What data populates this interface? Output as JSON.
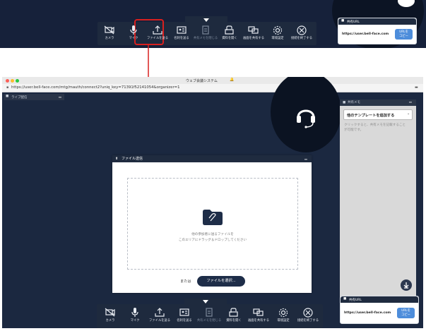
{
  "colors": {
    "navy": "#1e2a3e",
    "accent_blue": "#4d8ddb",
    "highlight_red": "#d9201f",
    "dialog_header": "#1f2b3f",
    "memo_gray": "#d9d9d9"
  },
  "toolbar_items": [
    {
      "label": "カメラ",
      "icon": "camera-off-icon"
    },
    {
      "label": "マイク",
      "icon": "microphone-icon"
    },
    {
      "label": "ファイルを送る",
      "icon": "upload-icon"
    },
    {
      "label": "名刺を送る",
      "icon": "business-card-icon"
    },
    {
      "label": "共有メモを閉じる",
      "icon": "memo-icon",
      "disabled": true
    },
    {
      "label": "資料を開く",
      "icon": "open-document-icon"
    },
    {
      "label": "画面を共有する",
      "icon": "screen-share-icon"
    },
    {
      "label": "環境設定",
      "icon": "settings-icon"
    },
    {
      "label": "接続を終了する",
      "icon": "end-call-icon"
    }
  ],
  "share_panel": {
    "title": "共有URL",
    "url": "https://user.bell-face.com",
    "copy_button": [
      "URLを",
      "コピー"
    ]
  },
  "browser": {
    "window_title": "ウェブ会議システム",
    "url": "https://user.bell-face.com/mtg/mauth/connect2?uniq_key=71391f52141054&organizer=1",
    "live_panel_label": "ライブ配信"
  },
  "memo": {
    "header": "共有メモ",
    "template_select": "他のテンプレートを追加する",
    "hint": "クリックすると、共有メモを記載することが可能です。"
  },
  "dialog": {
    "title": "ファイル送信",
    "drop_text_line1": "他の参加者に送るファイルを",
    "drop_text_line2": "このエリアにドラッグ＆ドロップしてください",
    "or_label": "または",
    "select_button": "ファイルを選択..."
  }
}
